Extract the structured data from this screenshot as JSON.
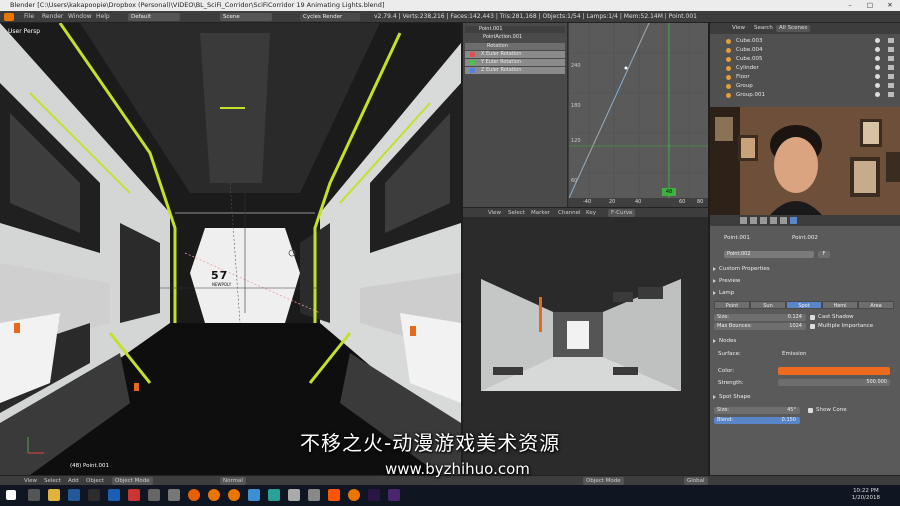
{
  "titlebar": {
    "title": "Blender [C:\\Users\\kakapoopie\\Dropbox (Personal)\\VIDEO\\BL_SciFi_Corridor\\SciFiCorridor 19 Animating Lights.blend]"
  },
  "menu": {
    "file": "File",
    "render": "Render",
    "window": "Window",
    "help": "Help",
    "layout": "Default",
    "scene": "Scene",
    "engine": "Cycles Render",
    "stats": "v2.79.4 | Verts:238,216 | Faces:142,443 | Tris:281,168 | Objects:1/54 | Lamps:1/4 | Mem:52.14M | Point.001"
  },
  "viewport": {
    "label": "User Persp",
    "sign": "57",
    "sign_sub": "NEWPOLY",
    "frame_label": "(48) Point.001"
  },
  "graph": {
    "object": "Point.001",
    "action": "PointAction.001",
    "channels": [
      {
        "name": "Rotation",
        "color": "#6b6b6b"
      },
      {
        "name": "X Euler Rotation",
        "color": "#e05050"
      },
      {
        "name": "Y Euler Rotation",
        "color": "#50c050"
      },
      {
        "name": "Z Euler Rotation",
        "color": "#5080e0"
      }
    ],
    "ruler": [
      "-40",
      "20",
      "40",
      "60",
      "80"
    ],
    "current_frame": "48",
    "yticks": [
      "240",
      "180",
      "120",
      "60"
    ],
    "menu": [
      "View",
      "Select",
      "Marker",
      "Channel",
      "Key"
    ],
    "mode": "F-Curve"
  },
  "outliner": {
    "view": "View",
    "search": "Search",
    "scope": "All Scenes",
    "items": [
      "Cube.003",
      "Cube.004",
      "Cube.005",
      "Cylinder",
      "Floor",
      "Group",
      "Group.001"
    ]
  },
  "props": {
    "breadcrumb1": "Point.001",
    "breadcrumb2": "Point.002",
    "name": "Point.002",
    "name_key": "F",
    "custom_props": "Custom Properties",
    "preview": "Preview",
    "lamp": "Lamp",
    "types": [
      "Point",
      "Sun",
      "Spot",
      "Hemi",
      "Area"
    ],
    "size_label": "Size:",
    "size_value": "0.124",
    "bounces_label": "Max Bounces:",
    "bounces_value": "1024",
    "cast_shadow": "Cast Shadow",
    "mis": "Multiple Importance",
    "nodes": "Nodes",
    "surface_label": "Surface:",
    "surface_value": "Emission",
    "color_label": "Color:",
    "color_value": "#ee6a1c",
    "strength_label": "Strength:",
    "strength_value": "500.000",
    "spot_shape": "Spot Shape",
    "spot_size_label": "Size:",
    "spot_size_value": "45°",
    "show_cone": "Show Cone",
    "blend_label": "Blend:",
    "blend_value": "0.150"
  },
  "bottom": {
    "view": "View",
    "select": "Select",
    "add": "Add",
    "object": "Object",
    "mode": "Object Mode",
    "shading": "Normal",
    "mode2": "Object Mode",
    "orient": "Global"
  },
  "taskbar": {
    "time": "10:22 PM",
    "date": "1/20/2018"
  },
  "watermark": {
    "line1": "不移之火-动漫游戏美术资源",
    "line2": "www.byzhihuo.com"
  }
}
